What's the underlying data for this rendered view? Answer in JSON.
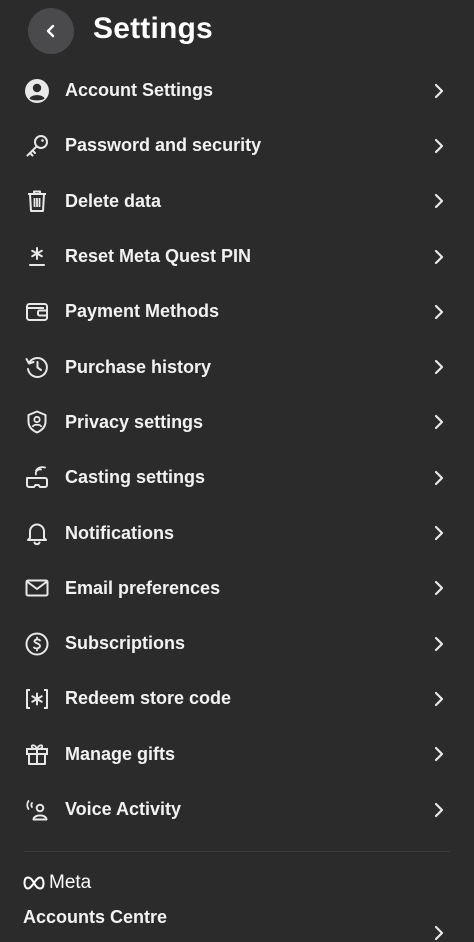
{
  "header": {
    "title": "Settings"
  },
  "menu": {
    "items": [
      {
        "label": "Account Settings",
        "icon": "account-circle-icon"
      },
      {
        "label": "Password and security",
        "icon": "key-icon"
      },
      {
        "label": "Delete data",
        "icon": "trash-icon"
      },
      {
        "label": "Reset Meta Quest PIN",
        "icon": "pin-asterisk-icon"
      },
      {
        "label": "Payment Methods",
        "icon": "wallet-icon"
      },
      {
        "label": "Purchase history",
        "icon": "history-icon"
      },
      {
        "label": "Privacy settings",
        "icon": "shield-user-icon"
      },
      {
        "label": "Casting settings",
        "icon": "casting-icon"
      },
      {
        "label": "Notifications",
        "icon": "bell-icon"
      },
      {
        "label": "Email preferences",
        "icon": "envelope-icon"
      },
      {
        "label": "Subscriptions",
        "icon": "dollar-circle-icon"
      },
      {
        "label": "Redeem store code",
        "icon": "bracket-asterisk-icon"
      },
      {
        "label": "Manage gifts",
        "icon": "gift-icon"
      },
      {
        "label": "Voice Activity",
        "icon": "voice-user-icon"
      }
    ]
  },
  "footer": {
    "brand": "Meta",
    "accounts_centre": "Accounts Centre"
  }
}
